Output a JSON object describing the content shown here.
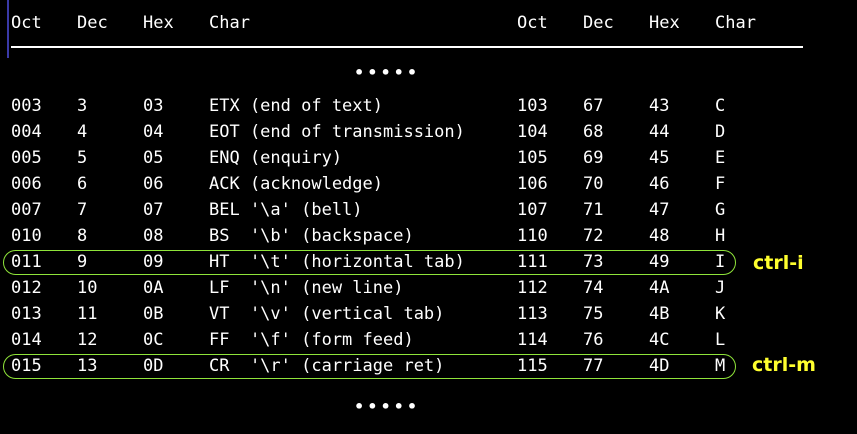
{
  "header": {
    "oct": "Oct",
    "dec": "Dec",
    "hex": "Hex",
    "char": "Char"
  },
  "ellipsis_top": "•••••",
  "ellipsis_bottom": "•••••",
  "rows": [
    {
      "oct1": "003",
      "dec1": "3",
      "hex1": "03",
      "char1": "ETX (end of text)",
      "oct2": "103",
      "dec2": "67",
      "hex2": "43",
      "char2": "C"
    },
    {
      "oct1": "004",
      "dec1": "4",
      "hex1": "04",
      "char1": "EOT (end of transmission)",
      "oct2": "104",
      "dec2": "68",
      "hex2": "44",
      "char2": "D"
    },
    {
      "oct1": "005",
      "dec1": "5",
      "hex1": "05",
      "char1": "ENQ (enquiry)",
      "oct2": "105",
      "dec2": "69",
      "hex2": "45",
      "char2": "E"
    },
    {
      "oct1": "006",
      "dec1": "6",
      "hex1": "06",
      "char1": "ACK (acknowledge)",
      "oct2": "106",
      "dec2": "70",
      "hex2": "46",
      "char2": "F"
    },
    {
      "oct1": "007",
      "dec1": "7",
      "hex1": "07",
      "char1": "BEL '\\a' (bell)",
      "oct2": "107",
      "dec2": "71",
      "hex2": "47",
      "char2": "G"
    },
    {
      "oct1": "010",
      "dec1": "8",
      "hex1": "08",
      "char1": "BS  '\\b' (backspace)",
      "oct2": "110",
      "dec2": "72",
      "hex2": "48",
      "char2": "H"
    },
    {
      "oct1": "011",
      "dec1": "9",
      "hex1": "09",
      "char1": "HT  '\\t' (horizontal tab)",
      "oct2": "111",
      "dec2": "73",
      "hex2": "49",
      "char2": "I"
    },
    {
      "oct1": "012",
      "dec1": "10",
      "hex1": "0A",
      "char1": "LF  '\\n' (new line)",
      "oct2": "112",
      "dec2": "74",
      "hex2": "4A",
      "char2": "J"
    },
    {
      "oct1": "013",
      "dec1": "11",
      "hex1": "0B",
      "char1": "VT  '\\v' (vertical tab)",
      "oct2": "113",
      "dec2": "75",
      "hex2": "4B",
      "char2": "K"
    },
    {
      "oct1": "014",
      "dec1": "12",
      "hex1": "0C",
      "char1": "FF  '\\f' (form feed)",
      "oct2": "114",
      "dec2": "76",
      "hex2": "4C",
      "char2": "L"
    },
    {
      "oct1": "015",
      "dec1": "13",
      "hex1": "0D",
      "char1": "CR  '\\r' (carriage ret)",
      "oct2": "115",
      "dec2": "77",
      "hex2": "4D",
      "char2": "M"
    }
  ],
  "annotations": {
    "ctrl_i": "ctrl-i",
    "ctrl_m": "ctrl-m"
  },
  "colors": {
    "background": "#000000",
    "text": "#ffffff",
    "highlight_outline": "#8fe43a",
    "annotation_text": "#ffff2e",
    "cursor": "#3a3aa8"
  }
}
